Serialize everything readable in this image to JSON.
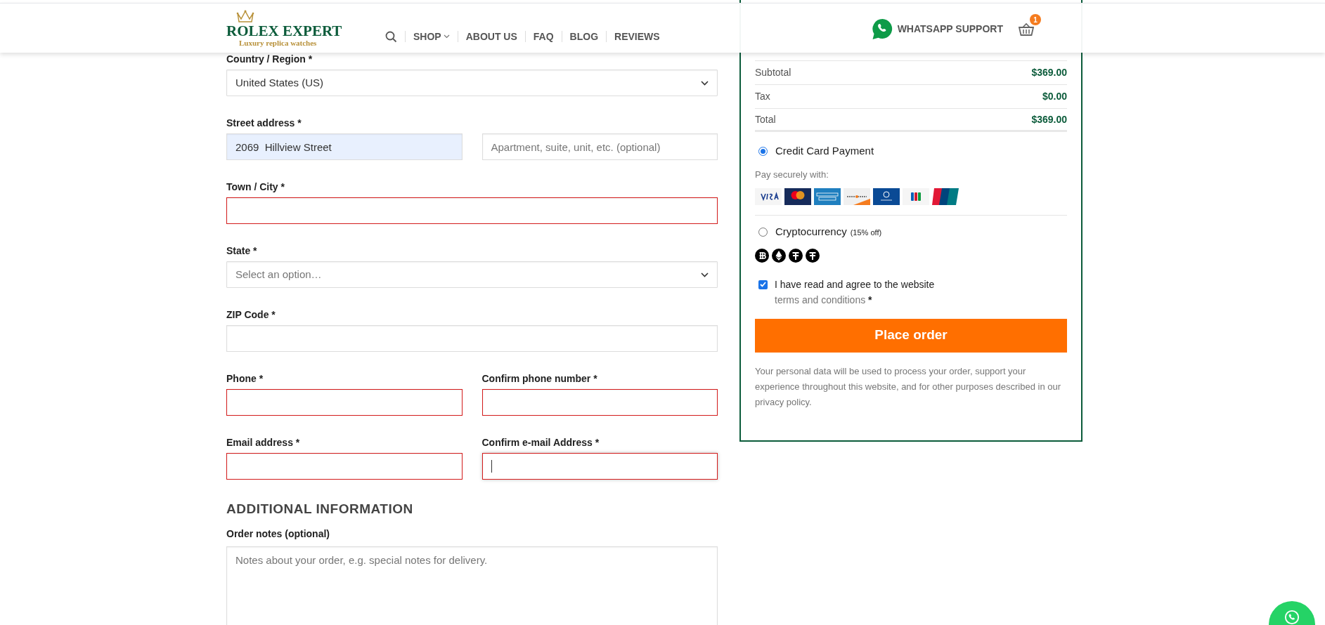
{
  "header": {
    "logo": {
      "title": "ROLEX EXPERT",
      "tagline": "Luxury replica watches"
    },
    "nav": [
      {
        "kind": "search"
      },
      {
        "kind": "dropdown",
        "label": "SHOP"
      },
      {
        "kind": "link",
        "label": "ABOUT US"
      },
      {
        "kind": "link",
        "label": "FAQ"
      },
      {
        "kind": "link",
        "label": "BLOG"
      },
      {
        "kind": "link",
        "label": "REVIEWS"
      }
    ],
    "whatsapp": "WHATSAPP SUPPORT",
    "cart_count": "1"
  },
  "form": {
    "rows": [
      {
        "columns": [
          {
            "label": "Country / Region *",
            "field": {
              "kind": "select",
              "value": "United States (US)",
              "invalid": false,
              "autofilled": false,
              "focused": false
            }
          }
        ]
      },
      {
        "columns": [
          {
            "label": "Street address *",
            "field": {
              "kind": "text",
              "value": "2069  Hillview Street",
              "invalid": false,
              "autofilled": true,
              "focused": false
            }
          },
          {
            "field": {
              "kind": "text",
              "placeholder": "Apartment, suite, unit, etc. (optional)",
              "invalid": false,
              "autofilled": false,
              "focused": false
            }
          }
        ]
      },
      {
        "columns": [
          {
            "label": "Town / City *",
            "field": {
              "kind": "text",
              "invalid": true,
              "autofilled": false,
              "focused": false
            }
          }
        ]
      },
      {
        "columns": [
          {
            "label": "State *",
            "field": {
              "kind": "select",
              "placeholder": "Select an option…",
              "invalid": false,
              "autofilled": false,
              "focused": false
            }
          }
        ]
      },
      {
        "columns": [
          {
            "label": "ZIP Code *",
            "field": {
              "kind": "text",
              "invalid": false,
              "autofilled": false,
              "focused": false
            }
          }
        ]
      },
      {
        "columns": [
          {
            "label": "Phone *",
            "field": {
              "kind": "text",
              "invalid": true,
              "autofilled": false,
              "focused": false
            }
          },
          {
            "label": "Confirm phone number *",
            "field": {
              "kind": "text",
              "invalid": true,
              "autofilled": false,
              "focused": false
            }
          }
        ]
      },
      {
        "columns": [
          {
            "label": "Email address *",
            "field": {
              "kind": "text",
              "invalid": true,
              "autofilled": false,
              "focused": false
            }
          },
          {
            "label": "Confirm e-mail Address *",
            "field": {
              "kind": "text",
              "invalid": true,
              "autofilled": false,
              "focused": true
            }
          }
        ]
      }
    ],
    "additional": {
      "heading": "ADDITIONAL INFORMATION",
      "label": "Order notes (optional)",
      "placeholder": "Notes about your order, e.g. special notes for delivery."
    }
  },
  "order": {
    "totals": [
      {
        "label": "Subtotal",
        "value": "$369.00"
      },
      {
        "label": "Tax",
        "value": "$0.00"
      },
      {
        "label": "Total",
        "value": "$369.00"
      }
    ],
    "payments": [
      {
        "kind": "cards",
        "label": "Credit Card Payment",
        "hint": "Pay securely with:",
        "selected": true
      },
      {
        "kind": "crypto",
        "label": "Cryptocurrency",
        "note": "(15% off)",
        "selected": false
      }
    ],
    "terms": {
      "text": "I have read and agree to the website",
      "link": "terms and conditions",
      "required": "*",
      "checked": true
    },
    "button": "Place order",
    "privacy": {
      "text": "Your personal data will be used to process your order, support your experience throughout this website, and for other purposes described in our",
      "link": "privacy policy",
      "after": "."
    }
  }
}
